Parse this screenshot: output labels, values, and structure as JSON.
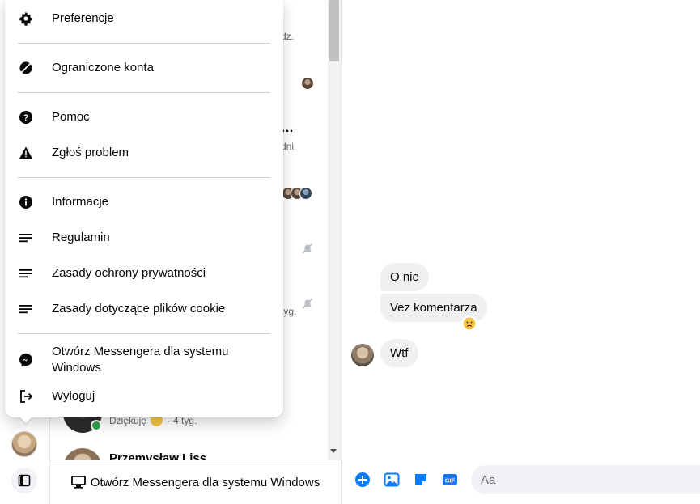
{
  "menu": {
    "items": [
      {
        "id": "preferences",
        "label": "Preferencje",
        "icon": "gear-icon"
      },
      {
        "id": "restricted",
        "label": "Ograniczone konta",
        "icon": "restricted-icon"
      },
      {
        "id": "help",
        "label": "Pomoc",
        "icon": "help-icon"
      },
      {
        "id": "report",
        "label": "Zgłoś problem",
        "icon": "warning-icon"
      },
      {
        "id": "info",
        "label": "Informacje",
        "icon": "info-icon"
      },
      {
        "id": "terms",
        "label": "Regulamin",
        "icon": "lines-icon"
      },
      {
        "id": "privacy",
        "label": "Zasady ochrony prywatności",
        "icon": "lines-icon"
      },
      {
        "id": "cookies",
        "label": "Zasady dotyczące plików cookie",
        "icon": "lines-icon"
      },
      {
        "id": "open-windows",
        "label": "Otwórz Messengera dla systemu Windows",
        "icon": "messenger-icon"
      },
      {
        "id": "logout",
        "label": "Wyloguj",
        "icon": "logout-icon"
      }
    ]
  },
  "conversations": {
    "peek_texts": [
      "dz.",
      "dni",
      "tyg."
    ],
    "visible_row": {
      "preview": "Dziękuję",
      "time": "· 4 tyg."
    },
    "next_row": {
      "name": "Przemysław Liss"
    }
  },
  "bottom_bar": {
    "open_windows_label": "Otwórz Messengera dla systemu Windows"
  },
  "chat": {
    "messages": [
      {
        "text": "O nie"
      },
      {
        "text": "Vez komentarza",
        "reaction": "sad-face"
      },
      {
        "text": "Wtf"
      }
    ]
  },
  "composer": {
    "placeholder": "Aa"
  },
  "colors": {
    "accent": "#0a7cff",
    "online": "#31a24c",
    "bubble": "#f0f0f0",
    "gif": "#1877f2"
  }
}
